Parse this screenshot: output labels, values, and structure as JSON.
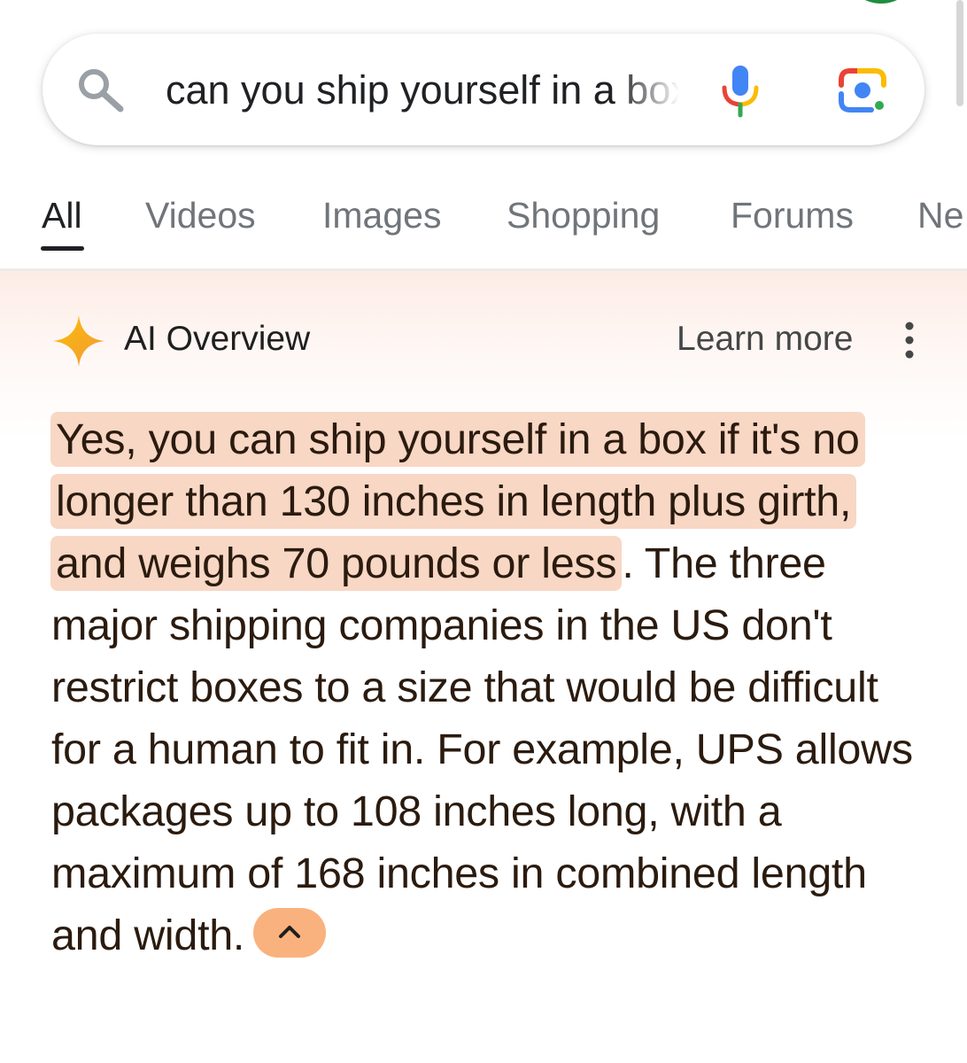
{
  "search": {
    "query": "can you ship yourself in a box"
  },
  "icons": {
    "search": "search-icon",
    "mic": "mic-icon",
    "lens": "google-lens-icon",
    "sparkle": "gemini-sparkle-icon",
    "more": "more-vert-icon",
    "collapse": "chevron-up-icon"
  },
  "tabs": [
    {
      "label": "All",
      "active": true
    },
    {
      "label": "Videos",
      "active": false
    },
    {
      "label": "Images",
      "active": false
    },
    {
      "label": "Shopping",
      "active": false
    },
    {
      "label": "Forums",
      "active": false
    },
    {
      "label": "Ne",
      "active": false
    }
  ],
  "ai_overview": {
    "title": "AI Overview",
    "learn_more": "Learn more",
    "highlighted_answer": "Yes, you can ship yourself in a box if it's no longer than 130 inches in length plus girth, and weighs 70 pounds or less",
    "after_highlight": ".",
    "body": " The three major shipping companies in the US don't restrict boxes to a size that would be difficult for a human to fit in. For example, UPS allows packages up to 108 inches long, with a maximum of 168 inches in combined length and width."
  },
  "colors": {
    "highlight": "#f8d7c5",
    "collapse_button": "#f9b27e",
    "panel_tint": "#fdece6",
    "text": "#2b1b0f",
    "tab_inactive": "#70757a"
  }
}
